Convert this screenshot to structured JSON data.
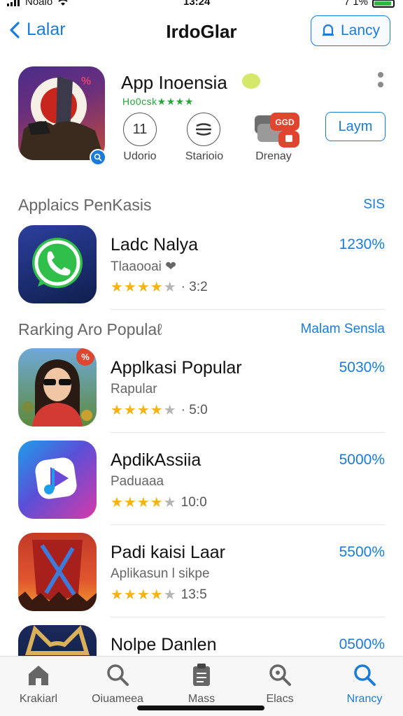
{
  "status_bar": {
    "carrier": "Noaio",
    "time": "13:24",
    "battery": "7 1%"
  },
  "nav": {
    "back_label": "Lalar",
    "title": "IrdoGlar",
    "action_label": "Lancy"
  },
  "featured": {
    "title": "App Inoensia",
    "subtitle": "Ho0csk★★★★",
    "icon_badge": "%",
    "actions": [
      {
        "glyph": "11",
        "label": "Udorio"
      },
      {
        "glyph": "≡",
        "label": "Starioio"
      },
      {
        "glyph": "GGD",
        "label": "Drenay"
      }
    ],
    "get_label": "Laym"
  },
  "sections": [
    {
      "title": "Applaics PenKasis",
      "link": "SIS"
    },
    {
      "title": "Rarking Aro Populaℓ",
      "link": "Malam Sensla"
    }
  ],
  "apps_top": [
    {
      "name": "Ladc Nalya",
      "sub": "Tlaaooai ❤",
      "stars": 4,
      "rating": "· 3:2",
      "price": "1230%"
    }
  ],
  "apps_popular": [
    {
      "name": "Applkasi Popular",
      "sub": "Rapular",
      "stars": 4,
      "rating": "· 5:0",
      "price": "5030%",
      "badge": "%"
    },
    {
      "name": "ApdikAssiia",
      "sub": "Paduaaa",
      "stars": 4,
      "rating": "10:0",
      "price": "5000%"
    },
    {
      "name": "Padi kaisi Laar",
      "sub": "Aplikasun l sikpe",
      "stars": 4,
      "rating": "13:5",
      "price": "5500%"
    },
    {
      "name": "Nolpe Danlen",
      "sub": "",
      "stars": 0,
      "rating": "",
      "price": "0500%"
    }
  ],
  "tabs": [
    {
      "label": "Krakiarl",
      "icon": "home-icon"
    },
    {
      "label": "Oiuameea",
      "icon": "search-icon"
    },
    {
      "label": "Mass",
      "icon": "clipboard-icon"
    },
    {
      "label": "Elacs",
      "icon": "search-icon"
    },
    {
      "label": "Nrancy",
      "icon": "search-icon",
      "active": true
    }
  ],
  "colors": {
    "accent": "#1a7bd8",
    "star": "#f2b417",
    "green": "#2aa23d"
  }
}
